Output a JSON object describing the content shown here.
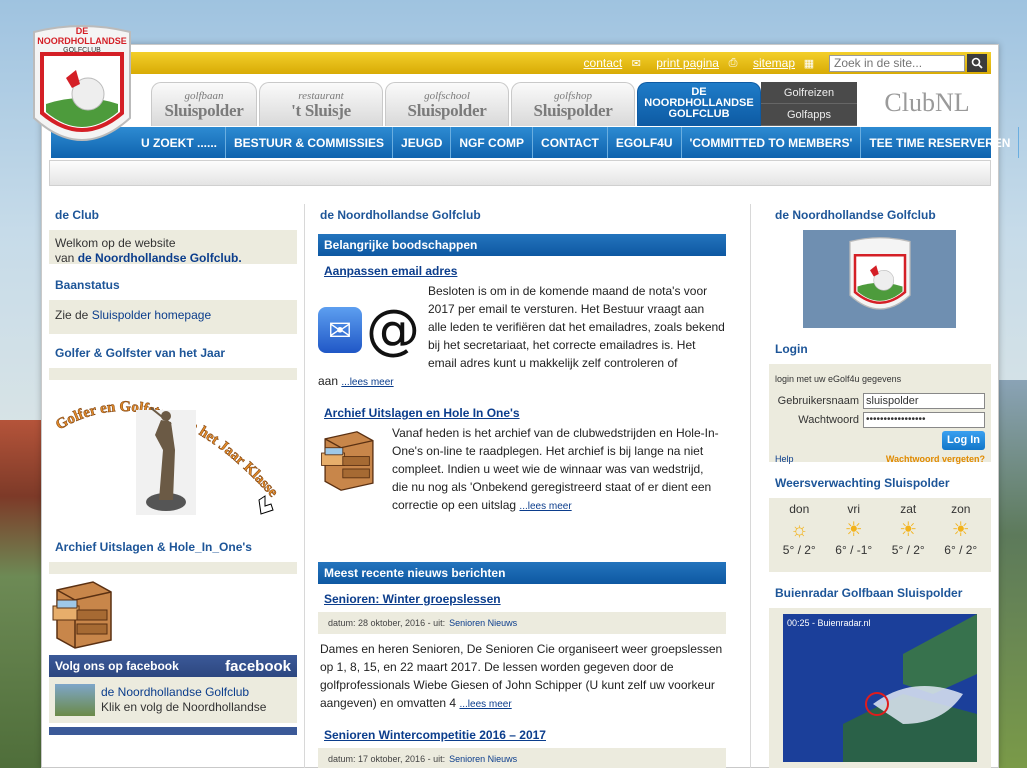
{
  "topbar": {
    "contact": "contact",
    "print": "print pagina",
    "sitemap": "sitemap",
    "search_placeholder": "Zoek in de site..."
  },
  "tabs": [
    {
      "small": "golfbaan",
      "big": "Sluispolder"
    },
    {
      "small": "restaurant",
      "big": "'t Sluisje"
    },
    {
      "small": "golfschool",
      "big": "Sluispolder"
    },
    {
      "small": "golfshop",
      "big": "Sluispolder"
    }
  ],
  "active_tab": {
    "line1": "DE",
    "line2": "NOORDHOLLANDSE",
    "line3": "GOLFCLUB"
  },
  "side_tabs": [
    "Golfreizen",
    "Golfapps"
  ],
  "clubnl": "ClubNL",
  "logo": {
    "top": "DE",
    "name": "NOORDHOLLANDSE",
    "sub": "GOLFCLUB"
  },
  "nav": [
    "U ZOEKT ......",
    "BESTUUR & COMMISSIES",
    "JEUGD",
    "NGF COMP",
    "CONTACT",
    "EGOLF4U",
    "'COMMITTED TO MEMBERS'",
    "TEE TIME RESERVEREN"
  ],
  "left": {
    "club_title": "de Club",
    "welcome": "Welkom op de website",
    "welcome_van": "van",
    "welcome_link": "de Noordhollandse Golfclub.",
    "baan_title": "Baanstatus",
    "baan_text": "Zie de",
    "baan_link": "Sluispolder homepage",
    "golfer_title": "Golfer & Golfster van het Jaar",
    "golfer_img_text": "Golfer en Golfster van het Jaar Klassement",
    "archief_title": "Archief Uitslagen & Hole_In_One's",
    "fb_title": "Volg ons op facebook",
    "fb_logo": "facebook",
    "fb_link": "de Noordhollandse Golfclub",
    "fb_sub": "Klik en volg de Noordhollandse"
  },
  "main": {
    "title": "de Noordhollandse Golfclub",
    "bar1": "Belangrijke boodschappen",
    "item1_title": "Aanpassen email adres",
    "item1_text": "Besloten is om in de komende maand de nota's voor 2017 per email te versturen. Het Bestuur vraagt aan alle leden te verifiëren dat het emailadres, zoals bekend bij het secretariaat, het correcte emailadres is. Het email adres kunt u makkelijk zelf controleren of",
    "item1_tail": "aan",
    "item2_title": "Archief Uitslagen en Hole In One's",
    "item2_text": "Vanaf heden is het archief van de clubwedstrijden en Hole-In-One's on-line te raadplegen. Het archief is bij lange na niet compleet. Indien u weet wie de winnaar was van wedstrijd, die nu nog als 'Onbekend geregistreerd staat of er dient een correctie op een uitslag",
    "lees": "...lees meer",
    "bar2": "Meest recente nieuws berichten",
    "news1_title": "Senioren: Winter groepslessen",
    "news1_datum": "datum: 28 oktober, 2016 -  uit:",
    "news1_cat": "Senioren Nieuws",
    "news1_text": "Dames en heren Senioren, De Senioren Cie organiseert weer groepslessen op 1, 8, 15, en 22 maart 2017. De lessen worden gegeven door de golfprofessionals Wiebe Giesen of John Schipper (U kunt zelf uw voorkeur aangeven) en omvatten 4",
    "news2_title": "Senioren Wintercompetitie 2016 – 2017",
    "news2_datum": "datum: 17 oktober, 2016 -  uit:",
    "news2_cat": "Senioren Nieuws"
  },
  "right": {
    "title": "de Noordhollandse Golfclub",
    "login_title": "Login",
    "login_info": "login met uw eGolf4u gegevens",
    "user_label": "Gebruikersnaam",
    "user_value": "sluispolder",
    "pass_label": "Wachtwoord",
    "pass_value": "•••••••••••••••••",
    "login_btn": "Log In",
    "help": "Help",
    "forgot": "Wachtwoord vergeten?",
    "weather_title": "Weersverwachting Sluispolder",
    "weather": [
      {
        "day": "don",
        "temp": "5° / 2°"
      },
      {
        "day": "vri",
        "temp": "6° / -1°"
      },
      {
        "day": "zat",
        "temp": "5° / 2°"
      },
      {
        "day": "zon",
        "temp": "6° / 2°"
      }
    ],
    "radar_title": "Buienradar Golfbaan Sluispolder",
    "radar_caption": "00:25 - Buienradar.nl"
  },
  "colors": {
    "blue": "#1565b0",
    "gold": "#e0b70d",
    "beige": "#ecebde"
  }
}
